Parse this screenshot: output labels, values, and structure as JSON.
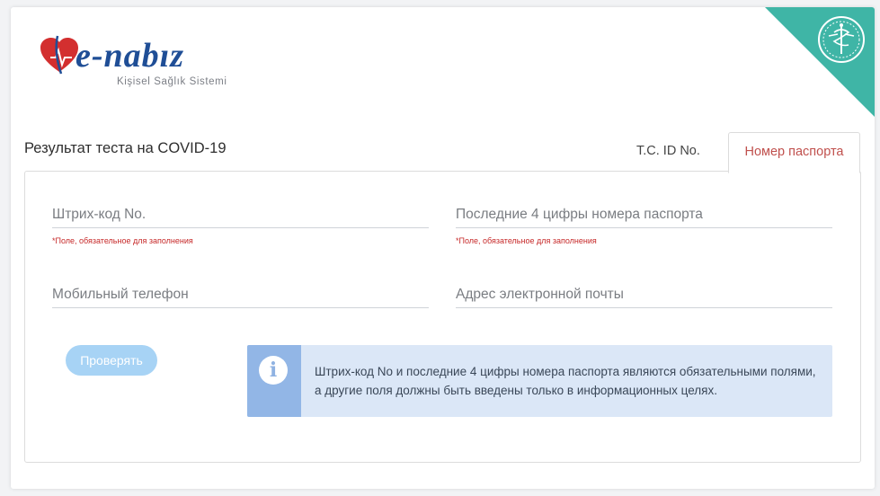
{
  "brand": {
    "name_prefix": "e-",
    "name_main": "nabız",
    "subtitle": "Kişisel Sağlık Sistemi"
  },
  "page_title": "Результат теста на COVID-19",
  "tabs": [
    {
      "label": "T.C. ID No.",
      "active": false
    },
    {
      "label": "Номер паспорта",
      "active": true
    }
  ],
  "form": {
    "barcode": {
      "placeholder": "Штрих-код No.",
      "value": "",
      "required_note": "*Поле, обязательное для заполнения"
    },
    "passport_last4": {
      "placeholder": "Последние 4 цифры номера паспорта",
      "value": "",
      "required_note": "*Поле, обязательное для заполнения"
    },
    "phone": {
      "placeholder": "Мобильный телефон",
      "value": ""
    },
    "email": {
      "placeholder": "Адрес электронной почты",
      "value": ""
    },
    "submit_label": "Проверять"
  },
  "info": {
    "icon": "info-icon",
    "text": "Штрих-код No и последние 4 цифры номера паспорта являются обязательными полями, а другие поля должны быть введены только в информационных целях."
  },
  "colors": {
    "corner": "#3fb5a6",
    "brand_blue": "#1f4e96",
    "brand_red": "#d32f2f",
    "active_tab": "#c0504d",
    "button": "#a7d3f5",
    "info_bg": "#dbe7f7",
    "info_side": "#92b6e6",
    "required": "#c62828"
  }
}
